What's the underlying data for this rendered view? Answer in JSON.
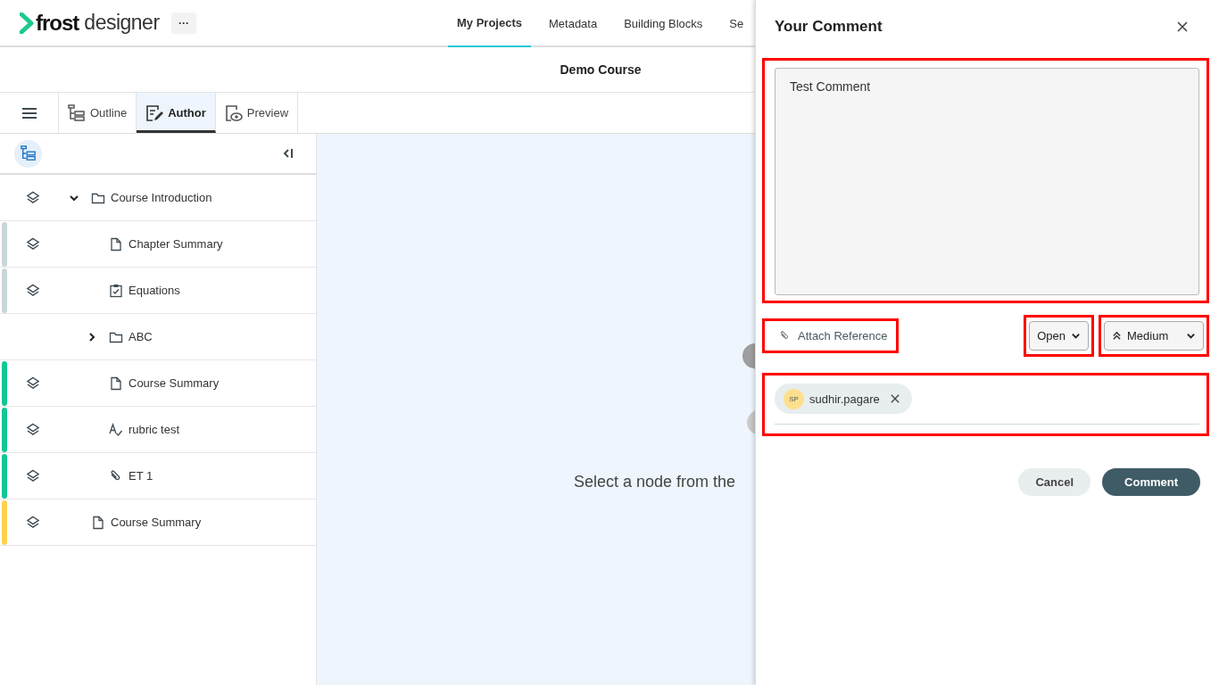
{
  "app": {
    "brand_bold": "frost",
    "brand_light": "designer",
    "more": "···"
  },
  "nav": [
    {
      "label": "My Projects",
      "selected": true
    },
    {
      "label": "Metadata",
      "selected": false
    },
    {
      "label": "Building Blocks",
      "selected": false
    },
    {
      "label": "Se",
      "selected": false
    }
  ],
  "course_title": "Demo Course",
  "view_tabs": [
    {
      "label": "Outline",
      "kind": "outline",
      "selected": false
    },
    {
      "label": "Author",
      "kind": "author",
      "selected": true
    },
    {
      "label": "Preview",
      "kind": "preview",
      "selected": false
    }
  ],
  "tree": [
    {
      "label": "Course Introduction",
      "kind": "folder",
      "layers": true,
      "expanded": true,
      "children": [
        {
          "label": "Chapter Summary",
          "kind": "page",
          "layers": true,
          "color": "#c9d6d7"
        },
        {
          "label": "Equations",
          "kind": "checklist",
          "layers": true,
          "color": "#c9d6d7"
        },
        {
          "label": "ABC",
          "kind": "folder",
          "layers": false,
          "expanded": false
        },
        {
          "label": "Course Summary",
          "kind": "page",
          "layers": true,
          "color": "#11c795"
        },
        {
          "label": "rubric test",
          "kind": "rubric",
          "layers": true,
          "color": "#11c795"
        },
        {
          "label": "ET 1",
          "kind": "link",
          "layers": true,
          "color": "#11c795"
        }
      ]
    },
    {
      "label": "Course Summary",
      "kind": "page",
      "layers": true,
      "color": "#ffd24d"
    }
  ],
  "empty_message": "Select a node from the",
  "comment": {
    "title": "Your Comment",
    "text": "Test Comment",
    "highlighted": true,
    "attach": {
      "label": "Attach Reference",
      "highlighted": true
    },
    "status": {
      "value": "Open",
      "highlighted": true
    },
    "priority": {
      "value": "Medium",
      "highlighted": true
    },
    "assignees": {
      "highlighted": true,
      "people": [
        {
          "initials": "SP",
          "name": "sudhir.pagare"
        }
      ]
    },
    "buttons": [
      {
        "label": "Cancel",
        "kind": "secondary"
      },
      {
        "label": "Comment",
        "kind": "primary"
      }
    ]
  }
}
